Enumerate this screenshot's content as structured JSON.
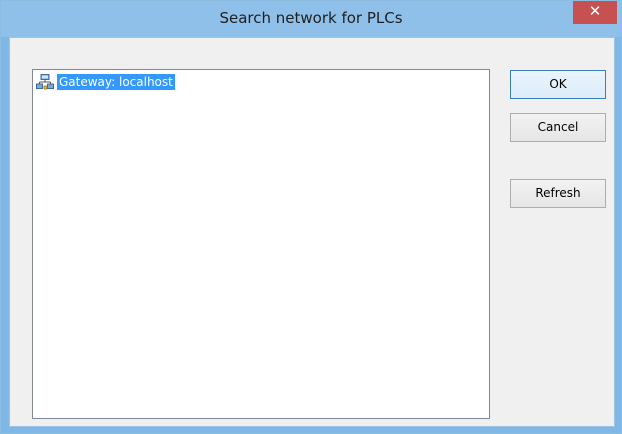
{
  "window": {
    "title": "Search network for PLCs",
    "close_glyph": "✕"
  },
  "tree": {
    "items": [
      {
        "label": "Gateway: localhost",
        "icon": "network-gateway-icon",
        "selected": true
      }
    ]
  },
  "buttons": {
    "ok_label": "OK",
    "cancel_label": "Cancel",
    "refresh_label": "Refresh"
  },
  "colors": {
    "titlebar": "#8ec0ea",
    "close_button": "#c75050",
    "selection": "#3399ff",
    "client_bg": "#f0f0f0"
  }
}
